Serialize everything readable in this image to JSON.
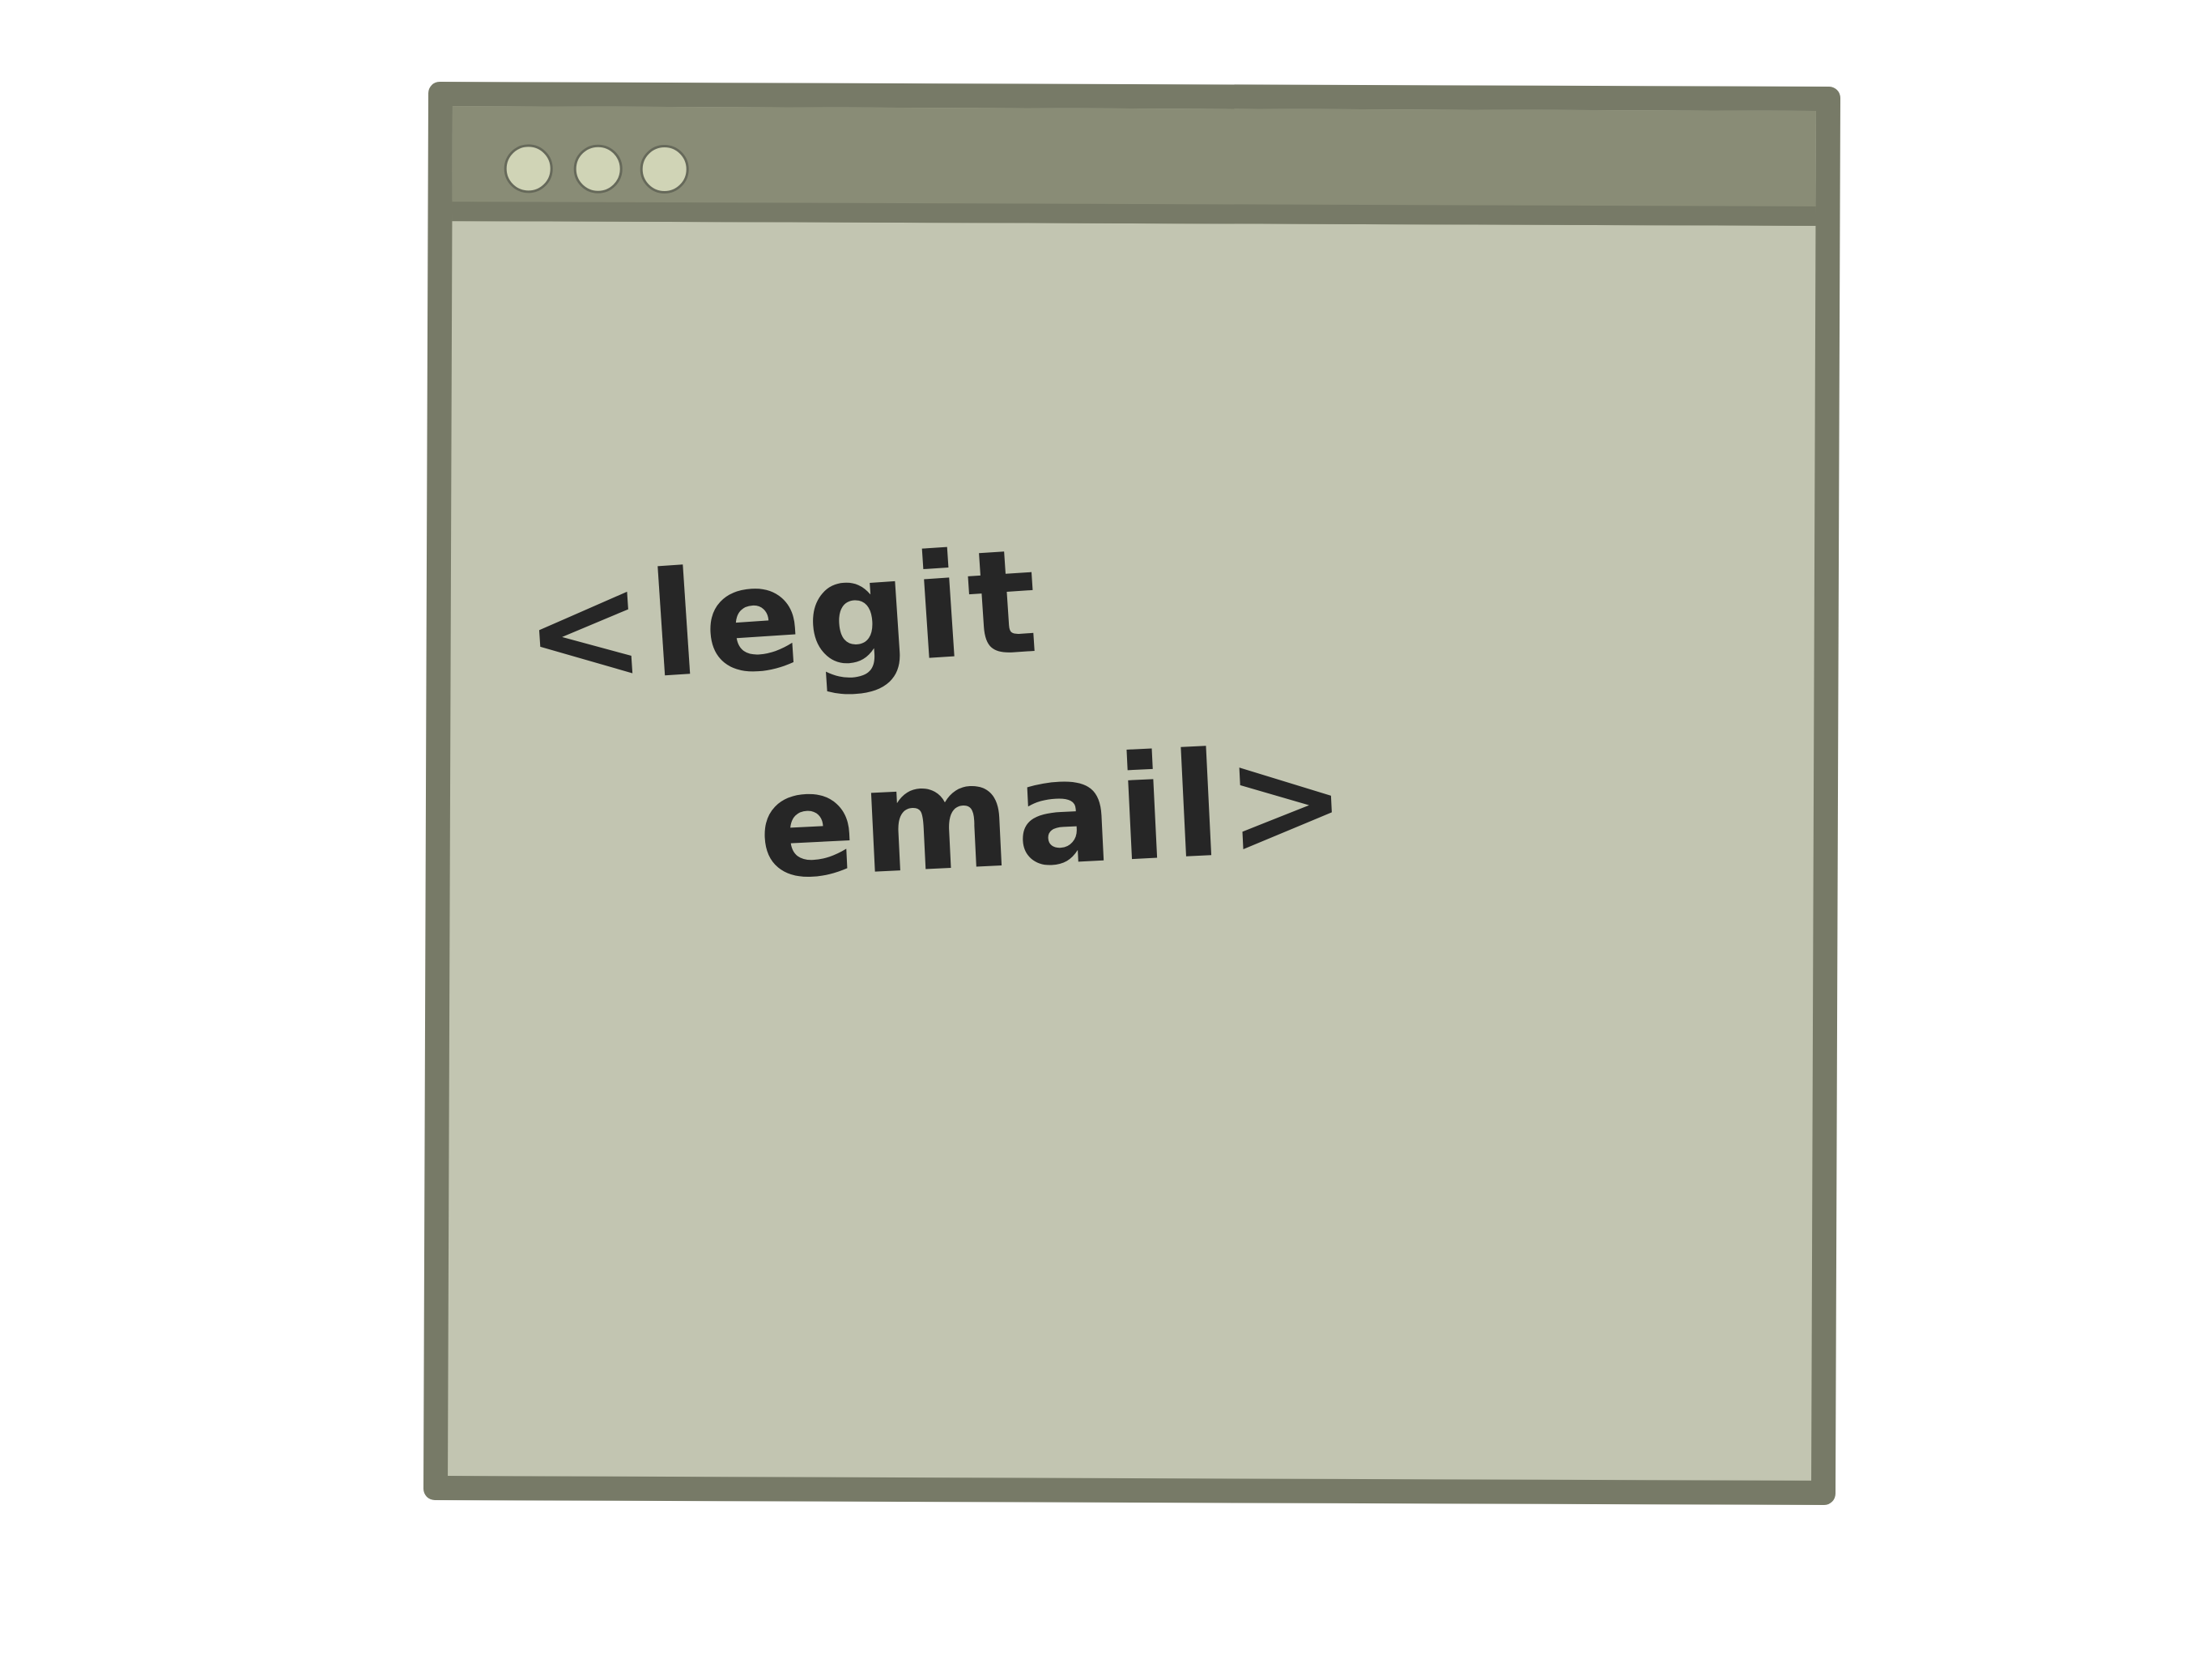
{
  "window": {
    "controls": [
      "close",
      "minimize",
      "maximize"
    ],
    "colors": {
      "frame": "#777a67",
      "titlebar": "#898c76",
      "content": "#c2c5b1",
      "control": "#d0d4b6",
      "ink": "#262626"
    }
  },
  "content": {
    "line1": "<legit",
    "line2": "email>"
  }
}
